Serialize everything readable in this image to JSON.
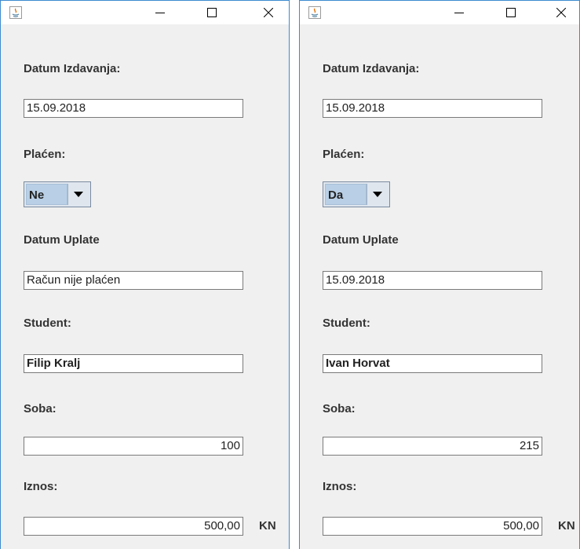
{
  "windows": [
    {
      "labels": {
        "datum_izdavanja": "Datum Izdavanja:",
        "placen": "Plaćen:",
        "datum_uplate": "Datum Uplate",
        "student": "Student:",
        "soba": "Soba:",
        "iznos": "Iznos:"
      },
      "datum_izdavanja_value": "15.09.2018",
      "placen_selected": "Ne",
      "datum_uplate_value": "Račun nije plaćen",
      "student_value": "Filip Kralj",
      "soba_value": "100",
      "iznos_value": "500,00",
      "currency": "KN"
    },
    {
      "labels": {
        "datum_izdavanja": "Datum Izdavanja:",
        "placen": "Plaćen:",
        "datum_uplate": "Datum Uplate",
        "student": "Student:",
        "soba": "Soba:",
        "iznos": "Iznos:"
      },
      "datum_izdavanja_value": "15.09.2018",
      "placen_selected": "Da",
      "datum_uplate_value": "15.09.2018",
      "student_value": "Ivan Horvat",
      "soba_value": "215",
      "iznos_value": "500,00",
      "currency": "KN"
    }
  ],
  "icons": {
    "app": "java-icon",
    "minimize": "minimize-icon",
    "maximize": "maximize-icon",
    "close": "close-icon",
    "dropdown": "chevron-down-icon"
  },
  "colors": {
    "window_border": "#3c8ad1",
    "panel_background": "#f0f0f0",
    "combo_selection": "#b8cfe5"
  }
}
